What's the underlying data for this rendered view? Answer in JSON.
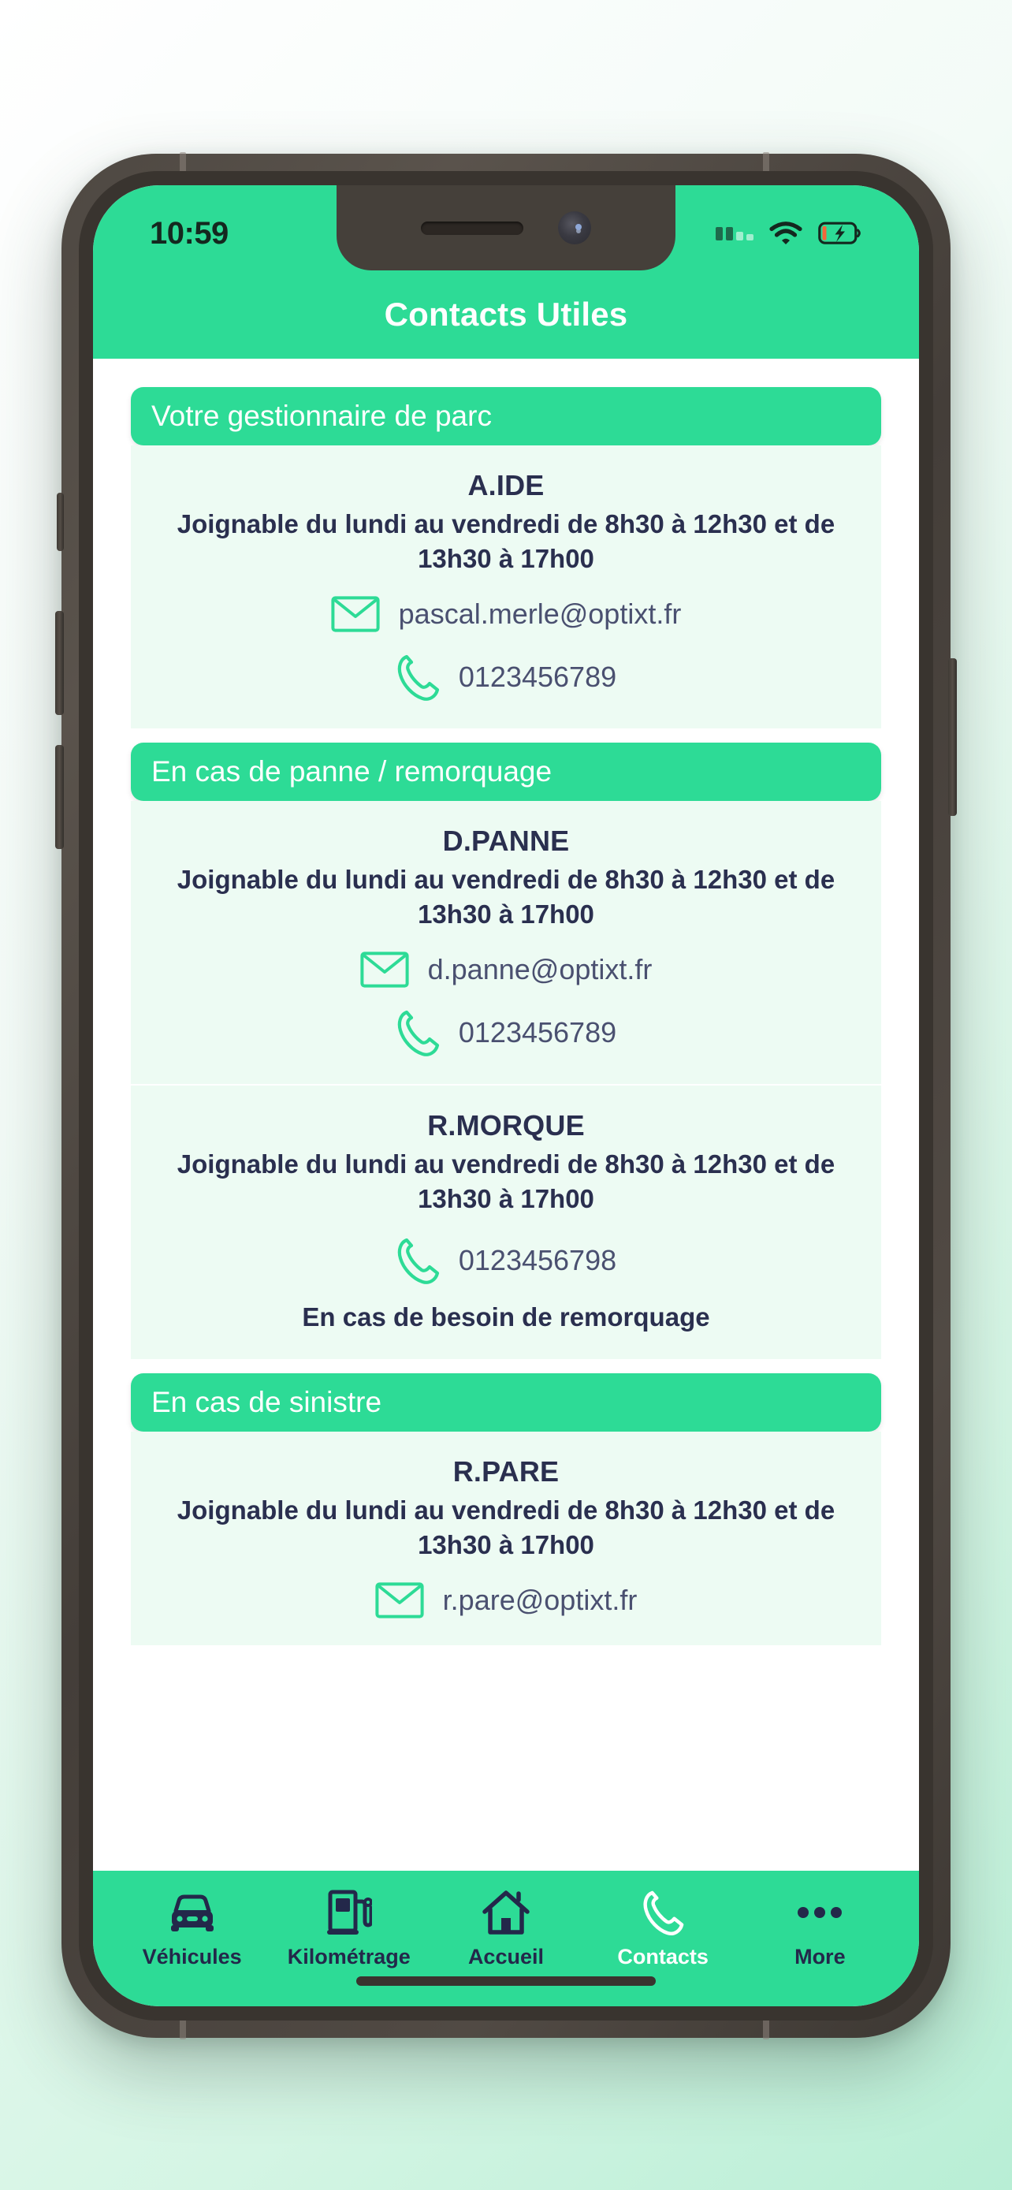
{
  "theme": {
    "brand_green": "#2ddb96",
    "card_mint": "#edfbf3",
    "text_navy": "#2a2f4f",
    "value_slate": "#4a5070",
    "frame_dark": "#45403a"
  },
  "status_bar": {
    "time": "10:59",
    "signal_icon": "cellular-signal-icon",
    "wifi_icon": "wifi-icon",
    "battery_icon": "battery-charging-icon"
  },
  "header": {
    "title": "Contacts Utiles"
  },
  "sections": [
    {
      "id": "gestionnaire",
      "title": "Votre gestionnaire de parc",
      "contacts": [
        {
          "name": "A.IDE",
          "hours": "Joignable du lundi au vendredi de 8h30 à 12h30 et de 13h30 à 17h00",
          "email": "pascal.merle@optixt.fr",
          "phone": "0123456789",
          "note": ""
        }
      ]
    },
    {
      "id": "panne-remorquage",
      "title": "En cas de panne / remorquage",
      "contacts": [
        {
          "name": "D.PANNE",
          "hours": "Joignable du lundi au vendredi de 8h30 à 12h30 et de 13h30 à 17h00",
          "email": "d.panne@optixt.fr",
          "phone": "0123456789",
          "note": ""
        },
        {
          "name": "R.MORQUE",
          "hours": "Joignable du lundi au vendredi de 8h30 à 12h30 et de 13h30 à 17h00",
          "email": "",
          "phone": "0123456798",
          "note": "En cas de besoin de remorquage"
        }
      ]
    },
    {
      "id": "sinistre",
      "title": "En cas de sinistre",
      "contacts": [
        {
          "name": "R.PARE",
          "hours": "Joignable du lundi au vendredi de 8h30 à 12h30 et de 13h30 à 17h00",
          "email": "r.pare@optixt.fr",
          "phone": "",
          "note": ""
        }
      ]
    }
  ],
  "tab_bar": {
    "items": [
      {
        "label": "Véhicules",
        "icon": "car-icon",
        "active": false
      },
      {
        "label": "Kilométrage",
        "icon": "fuel-pump-icon",
        "active": false
      },
      {
        "label": "Accueil",
        "icon": "home-icon",
        "active": false
      },
      {
        "label": "Contacts",
        "icon": "phone-icon",
        "active": true
      },
      {
        "label": "More",
        "icon": "ellipsis-icon",
        "active": false
      }
    ]
  }
}
